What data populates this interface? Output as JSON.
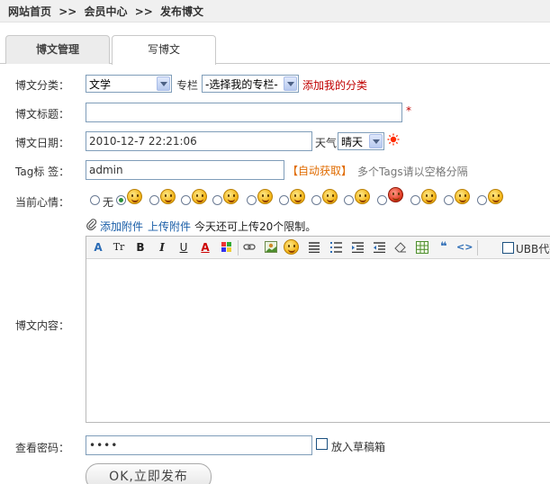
{
  "breadcrumb": {
    "home": "网站首页",
    "sep1": ">>",
    "member": "会员中心",
    "sep2": ">>",
    "current": "发布博文"
  },
  "tabs": {
    "manage": "博文管理",
    "write": "写博文"
  },
  "form": {
    "category_label": "博文分类：",
    "category_value": "文学",
    "column_label": "专栏",
    "column_value": "-选择我的专栏-",
    "add_category_link": "添加我的分类",
    "title_label": "博文标题：",
    "title_value": "",
    "required_mark": "*",
    "date_label": "博文日期：",
    "date_value": "2010-12-7 22:21:06",
    "weather_label": "天气",
    "weather_value": "晴天",
    "tag_label": "Tag标 签：",
    "tag_value": "admin",
    "auto_fetch_link": "【自动获取】",
    "tag_hint": "多个Tags请以空格分隔",
    "mood_label": "当前心情：",
    "mood_none": "无",
    "attach_add_link": "添加附件",
    "attach_upload_link": "上传附件",
    "attach_limit": "今天还可上传20个限制。",
    "content_label": "博文内容：",
    "ubb_label": "UBB代码",
    "password_label": "查看密码：",
    "password_value": "••••",
    "draft_label": "放入草稿箱",
    "publish_button": "OK,立即发布"
  },
  "toolbar_icons": [
    "font-face-icon",
    "font-size-icon",
    "bold-icon",
    "italic-icon",
    "underline-icon",
    "font-color-icon",
    "bg-color-icon",
    "link-icon",
    "image-icon",
    "emoticon-icon",
    "align-icon",
    "ordered-list-icon",
    "indent-icon",
    "outdent-icon",
    "eraser-icon",
    "table-icon",
    "quote-icon",
    "code-icon"
  ],
  "toolbar_glyphs": {
    "bold": "B",
    "italic": "I",
    "underline": "U",
    "font_color": "A",
    "font_size": "Tr"
  },
  "colors": {
    "accent_red": "#c00000",
    "accent_orange": "#e06b00",
    "link_blue": "#1a5ea8"
  }
}
